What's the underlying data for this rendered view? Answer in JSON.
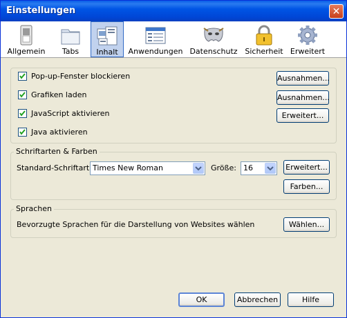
{
  "window": {
    "title": "Einstellungen",
    "close_glyph": "✕"
  },
  "toolbar": {
    "tabs": [
      {
        "label": "Allgemein",
        "icon": "switch-icon"
      },
      {
        "label": "Tabs",
        "icon": "folder-tabs-icon"
      },
      {
        "label": "Inhalt",
        "icon": "content-icon",
        "selected": true
      },
      {
        "label": "Anwendungen",
        "icon": "applications-icon"
      },
      {
        "label": "Datenschutz",
        "icon": "mask-icon"
      },
      {
        "label": "Sicherheit",
        "icon": "lock-icon"
      },
      {
        "label": "Erweitert",
        "icon": "gear-icon"
      }
    ]
  },
  "content": {
    "checkboxes": [
      {
        "label": "Pop-up-Fenster blockieren",
        "checked": true
      },
      {
        "label": "Grafiken laden",
        "checked": true
      },
      {
        "label": "JavaScript aktivieren",
        "checked": true
      },
      {
        "label": "Java aktivieren",
        "checked": true
      }
    ],
    "buttons": {
      "popup_exceptions": "Ausnahmen...",
      "images_exceptions": "Ausnahmen...",
      "js_advanced": "Erweitert..."
    }
  },
  "fonts": {
    "group_title": "Schriftarten & Farben",
    "default_font_label": "Standard-Schriftart:",
    "default_font_value": "Times New Roman",
    "size_label": "Größe:",
    "size_value": "16",
    "advanced_button": "Erweitert...",
    "colors_button": "Farben..."
  },
  "languages": {
    "group_title": "Sprachen",
    "description": "Bevorzugte Sprachen für die Darstellung von Websites wählen",
    "choose_button": "Wählen..."
  },
  "footer": {
    "ok": "OK",
    "cancel": "Abbrechen",
    "help": "Hilfe"
  }
}
